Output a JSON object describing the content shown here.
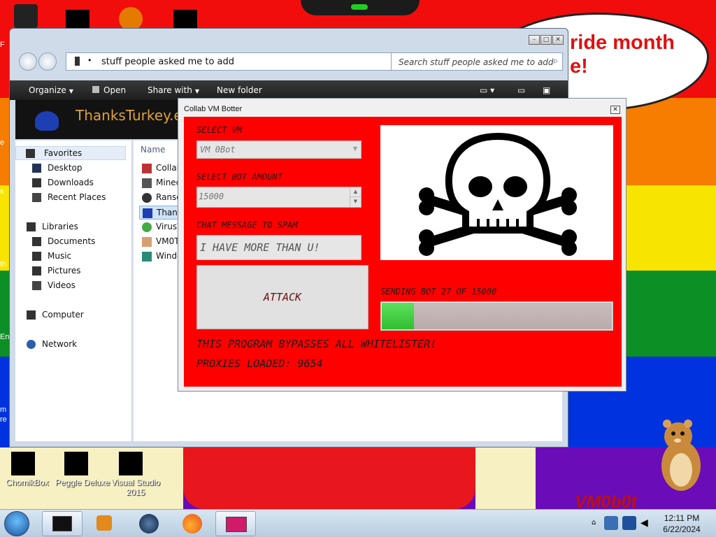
{
  "desktop": {
    "banner_text": "ride month",
    "banner_text_2": "e!",
    "left_edge_texts": [
      "F",
      "e",
      "s",
      "th",
      "En",
      "m",
      "re"
    ],
    "icons": [
      {
        "label": "ChomikBox"
      },
      {
        "label": "Peggle Deluxe"
      },
      {
        "label": "Visual Studio 2015"
      }
    ],
    "watermark": "VM0b0t"
  },
  "explorer": {
    "address": "stuff people asked me to add",
    "search_placeholder": "Search stuff people asked me to add",
    "toolbar": {
      "organize": "Organize",
      "open": "Open",
      "share_with": "Share with",
      "new_folder": "New folder"
    },
    "preview_title": "ThanksTurkey.exe",
    "nav": {
      "favorites": "Favorites",
      "desktop": "Desktop",
      "downloads": "Downloads",
      "recent_places": "Recent Places",
      "libraries": "Libraries",
      "documents": "Documents",
      "music": "Music",
      "pictures": "Pictures",
      "videos": "Videos",
      "computer": "Computer",
      "network": "Network"
    },
    "column_name": "Name",
    "files": [
      "Collab",
      "Minec",
      "Ranso",
      "Thank",
      "VirusW",
      "VM0T",
      "Windo"
    ]
  },
  "botter": {
    "title": "Collab VM Botter",
    "select_vm_label": "SELECT VM",
    "select_vm_value": "VM 0Bot",
    "bot_amount_label": "SELECT BOT AMOUNT",
    "bot_amount_value": "15000",
    "chat_label": "CHAT MESSAGE TO SPAM",
    "chat_value": "I HAVE MORE THAN U!",
    "attack_label": "ATTACK",
    "status_label": "SENDING BOT 27 OF 15000",
    "progress_fraction": 0.14,
    "bypass_text": "THIS PROGRAM BYPASSES ALL WHITELISTER!",
    "proxies_text": "PROXIES LOADED: 9654",
    "skull_icon": "skull-crossbones-icon"
  },
  "taskbar": {
    "time": "12:11 PM",
    "date": "6/22/2024",
    "pinned": [
      "terminal",
      "media-player",
      "web-browser",
      "firefox",
      "image-viewer"
    ]
  },
  "colors": {
    "botter_bg": "#ff0000",
    "progress_fill": "#3fd23f"
  }
}
